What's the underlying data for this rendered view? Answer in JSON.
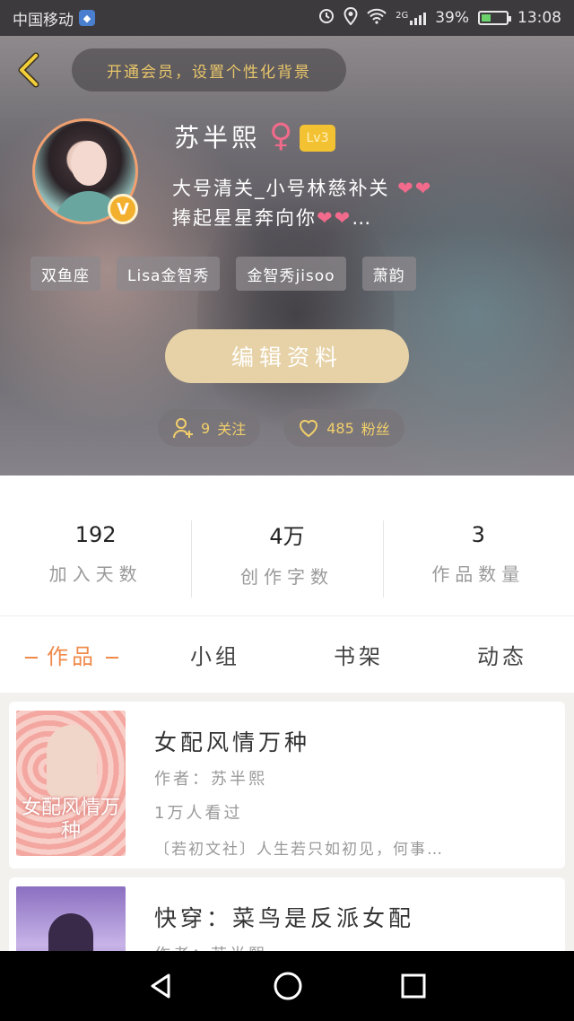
{
  "status_bar": {
    "carrier": "中国移动",
    "network": "2G",
    "battery": "39%",
    "time": "13:08",
    "battery_level": 0.39
  },
  "header": {
    "vip_banner": "开通会员，设置个性化背景",
    "username": "苏半熙",
    "gender_symbol": "♀",
    "level": "Lv3",
    "verified_badge": "V",
    "bio_line1": "大号清关_小号林慈补关",
    "bio_line2": "捧起星星奔向你",
    "bio_ellipsis": "…",
    "tags": [
      "双鱼座",
      "Lisa金智秀",
      "金智秀jisoo",
      "萧韵"
    ],
    "edit_button": "编辑资料",
    "follow_count": "9",
    "follow_label": "关注",
    "fans_count": "485",
    "fans_label": "粉丝"
  },
  "stats": [
    {
      "value": "192",
      "label": "加入天数"
    },
    {
      "value": "4万",
      "label": "创作字数"
    },
    {
      "value": "3",
      "label": "作品数量"
    }
  ],
  "tabs": [
    {
      "label": "作品",
      "active": true
    },
    {
      "label": "小组",
      "active": false
    },
    {
      "label": "书架",
      "active": false
    },
    {
      "label": "动态",
      "active": false
    }
  ],
  "works": [
    {
      "title": "女配风情万种",
      "author": "作者：苏半熙",
      "views": "1万人看过",
      "description": "〔若初文社〕人生若只如初见，何事…",
      "cover_text": "女配风情万种"
    },
    {
      "title": "快穿：菜鸟是反派女配",
      "author": "作者：苏半熙",
      "views": "",
      "description": ""
    }
  ],
  "colors": {
    "accent": "#ef8a4a",
    "gold": "#f2cf6a",
    "edit_button": "#e6d2a6",
    "level_badge": "#f3c233",
    "gender": "#f06a8a"
  },
  "icons": {
    "back": "chevron-left-icon",
    "follow": "add-user-icon",
    "fans": "heart-icon",
    "nav": [
      "back-triangle-icon",
      "home-circle-icon",
      "recents-square-icon"
    ]
  }
}
